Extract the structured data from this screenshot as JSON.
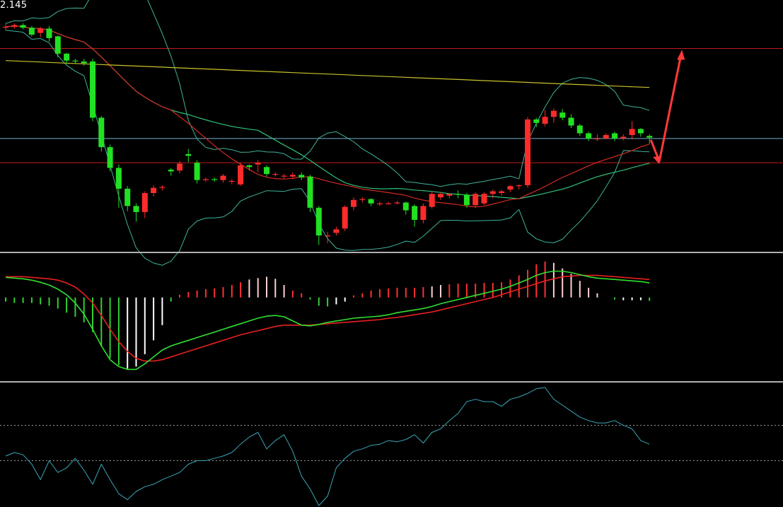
{
  "price_readout": "2.145",
  "colors": {
    "background": "#000000",
    "up_candle": "#ff2b2b",
    "down_candle": "#22e022",
    "boll_bands": "#3fb39a",
    "ma_red": "#d42a22",
    "ma_green": "#2fc27a",
    "ma_yellow": "#c8c22a",
    "level_line": "#c11b1b",
    "current_line": "#6fb0c8",
    "macd_dif": "#30e030",
    "macd_dea": "#e82020",
    "hist_pos": "#ff3030",
    "hist_pos_fade": "#ffd0d0",
    "hist_neg": "#30d030",
    "hist_neg_fade": "#ffffff",
    "oscillator": "#3aa6b9",
    "panel_divider": "#b0b0b0",
    "arrow": "#ff3a3a"
  },
  "chart_data": [
    {
      "type": "candlestick",
      "panel": "price",
      "ylim": [
        1.87,
        2.16
      ],
      "x_count": 75,
      "candles": [
        [
          2.129,
          2.129,
          2.125,
          2.133
        ],
        [
          2.129,
          2.131,
          2.127,
          2.133
        ],
        [
          2.131,
          2.128,
          2.126,
          2.133
        ],
        [
          2.128,
          2.12,
          2.118,
          2.13
        ],
        [
          2.122,
          2.127,
          2.117,
          2.129
        ],
        [
          2.127,
          2.116,
          2.112,
          2.13
        ],
        [
          2.118,
          2.098,
          2.094,
          2.119
        ],
        [
          2.098,
          2.09,
          2.086,
          2.099
        ],
        [
          2.09,
          2.089,
          2.086,
          2.092
        ],
        [
          2.089,
          2.087,
          2.084,
          2.092
        ],
        [
          2.089,
          2.024,
          2.02,
          2.092
        ],
        [
          2.024,
          1.99,
          1.985,
          2.026
        ],
        [
          1.99,
          1.966,
          1.962,
          1.993
        ],
        [
          1.966,
          1.942,
          1.92,
          1.97
        ],
        [
          1.942,
          1.922,
          1.916,
          1.945
        ],
        [
          1.922,
          1.915,
          1.904,
          1.925
        ],
        [
          1.915,
          1.937,
          1.908,
          1.939
        ],
        [
          1.937,
          1.943,
          1.933,
          1.946
        ],
        [
          1.943,
          1.944,
          1.94,
          1.946
        ],
        [
          1.964,
          1.962,
          1.957,
          1.966
        ],
        [
          1.963,
          1.971,
          1.96,
          1.974
        ],
        [
          1.982,
          1.98,
          1.973,
          1.988
        ],
        [
          1.972,
          1.952,
          1.948,
          1.975
        ],
        [
          1.952,
          1.953,
          1.95,
          1.955
        ],
        [
          1.953,
          1.952,
          1.95,
          1.955
        ],
        [
          1.952,
          1.957,
          1.949,
          1.959
        ],
        [
          1.95,
          1.951,
          1.947,
          1.953
        ],
        [
          1.947,
          1.969,
          1.945,
          1.972
        ],
        [
          1.969,
          1.967,
          1.963,
          1.97
        ],
        [
          1.97,
          1.972,
          1.961,
          1.975
        ],
        [
          1.967,
          1.959,
          1.956,
          1.969
        ],
        [
          1.959,
          1.959,
          1.956,
          1.961
        ],
        [
          1.957,
          1.957,
          1.954,
          1.959
        ],
        [
          1.956,
          1.958,
          1.953,
          1.961
        ],
        [
          1.958,
          1.955,
          1.952,
          1.961
        ],
        [
          1.956,
          1.92,
          1.915,
          1.958
        ],
        [
          1.92,
          1.888,
          1.877,
          1.922
        ],
        [
          1.888,
          1.888,
          1.879,
          1.892
        ],
        [
          1.891,
          1.895,
          1.888,
          1.898
        ],
        [
          1.896,
          1.921,
          1.893,
          1.923
        ],
        [
          1.921,
          1.929,
          1.917,
          1.932
        ],
        [
          1.929,
          1.93,
          1.926,
          1.932
        ],
        [
          1.93,
          1.925,
          1.922,
          1.931
        ],
        [
          1.925,
          1.925,
          1.922,
          1.927
        ],
        [
          1.925,
          1.925,
          1.924,
          1.927
        ],
        [
          1.925,
          1.926,
          1.924,
          1.928
        ],
        [
          1.926,
          1.917,
          1.912,
          1.927
        ],
        [
          1.922,
          1.906,
          1.898,
          1.924
        ],
        [
          1.906,
          1.922,
          1.902,
          1.925
        ],
        [
          1.921,
          1.936,
          1.919,
          1.939
        ],
        [
          1.932,
          1.936,
          1.929,
          1.938
        ],
        [
          1.934,
          1.936,
          1.931,
          1.937
        ],
        [
          1.936,
          1.935,
          1.931,
          1.94
        ],
        [
          1.935,
          1.923,
          1.92,
          1.937
        ],
        [
          1.923,
          1.936,
          1.92,
          1.938
        ],
        [
          1.925,
          1.936,
          1.923,
          1.938
        ],
        [
          1.936,
          1.939,
          1.931,
          1.941
        ],
        [
          1.937,
          1.939,
          1.934,
          1.941
        ],
        [
          1.941,
          1.945,
          1.938,
          1.946
        ],
        [
          1.945,
          1.946,
          1.941,
          1.947
        ],
        [
          1.946,
          2.022,
          1.943,
          2.025
        ],
        [
          2.022,
          2.018,
          2.013,
          2.024
        ],
        [
          2.017,
          2.025,
          2.014,
          2.033
        ],
        [
          2.025,
          2.032,
          2.018,
          2.035
        ],
        [
          2.03,
          2.024,
          2.021,
          2.034
        ],
        [
          2.024,
          2.015,
          2.012,
          2.028
        ],
        [
          2.015,
          2.006,
          2.003,
          2.017
        ],
        [
          2.006,
          2.0,
          1.997,
          2.008
        ],
        [
          2.0,
          2.0,
          1.997,
          2.005
        ],
        [
          2.0,
          2.004,
          1.999,
          2.006
        ],
        [
          2.006,
          2.0,
          1.997,
          2.008
        ],
        [
          2.0,
          2.002,
          1.998,
          2.005
        ],
        [
          2.004,
          2.011,
          1.999,
          2.02
        ],
        [
          2.011,
          2.006,
          2.002,
          2.012
        ],
        [
          2.003,
          2.001,
          1.994,
          2.005
        ]
      ],
      "level_lines": [
        2.104,
        1.972
      ],
      "current_line": 2.0
    },
    {
      "type": "bar+line",
      "panel": "macd",
      "ylim": [
        -0.12,
        0.06
      ],
      "x_count": 75,
      "histogram": [
        -0.006,
        -0.008,
        -0.008,
        -0.008,
        -0.01,
        -0.012,
        -0.016,
        -0.022,
        -0.028,
        -0.036,
        -0.05,
        -0.07,
        -0.088,
        -0.098,
        -0.103,
        -0.1,
        -0.082,
        -0.062,
        -0.04,
        -0.006,
        0.004,
        0.008,
        0.01,
        0.012,
        0.013,
        0.015,
        0.018,
        0.022,
        0.026,
        0.028,
        0.03,
        0.027,
        0.018,
        0.01,
        0.006,
        -0.003,
        -0.012,
        -0.013,
        -0.01,
        -0.006,
        0.003,
        0.006,
        0.01,
        0.012,
        0.013,
        0.014,
        0.014,
        0.014,
        0.015,
        0.016,
        0.018,
        0.019,
        0.02,
        0.02,
        0.02,
        0.021,
        0.021,
        0.022,
        0.026,
        0.032,
        0.04,
        0.048,
        0.052,
        0.05,
        0.042,
        0.034,
        0.024,
        0.014,
        0.006,
        0.0,
        -0.003,
        -0.004,
        -0.004,
        -0.004,
        -0.005
      ],
      "histogram_faded": [
        false,
        false,
        false,
        false,
        false,
        false,
        false,
        false,
        false,
        false,
        false,
        false,
        false,
        false,
        true,
        true,
        true,
        true,
        true,
        false,
        false,
        false,
        false,
        false,
        false,
        false,
        false,
        false,
        true,
        true,
        true,
        true,
        true,
        false,
        false,
        false,
        false,
        false,
        true,
        true,
        false,
        false,
        false,
        false,
        false,
        false,
        false,
        false,
        false,
        true,
        true,
        false,
        false,
        false,
        false,
        false,
        false,
        false,
        false,
        false,
        false,
        false,
        false,
        true,
        true,
        true,
        true,
        true,
        true,
        false,
        false,
        true,
        true,
        true,
        false
      ],
      "series": [
        {
          "role": "dif",
          "values": [
            0.029,
            0.028,
            0.027,
            0.025,
            0.022,
            0.018,
            0.012,
            0.004,
            -0.008,
            -0.024,
            -0.046,
            -0.07,
            -0.09,
            -0.1,
            -0.104,
            -0.104,
            -0.096,
            -0.086,
            -0.076,
            -0.07,
            -0.066,
            -0.062,
            -0.058,
            -0.054,
            -0.05,
            -0.046,
            -0.042,
            -0.038,
            -0.034,
            -0.03,
            -0.027,
            -0.026,
            -0.028,
            -0.034,
            -0.04,
            -0.041,
            -0.039,
            -0.036,
            -0.034,
            -0.032,
            -0.03,
            -0.029,
            -0.028,
            -0.027,
            -0.025,
            -0.022,
            -0.02,
            -0.018,
            -0.016,
            -0.013,
            -0.009,
            -0.006,
            -0.003,
            0.0,
            0.003,
            0.006,
            0.009,
            0.012,
            0.016,
            0.021,
            0.026,
            0.032,
            0.036,
            0.038,
            0.038,
            0.036,
            0.033,
            0.03,
            0.028,
            0.027,
            0.026,
            0.025,
            0.024,
            0.023,
            0.021
          ]
        },
        {
          "role": "dea",
          "values": [
            0.03,
            0.03,
            0.03,
            0.029,
            0.028,
            0.027,
            0.025,
            0.021,
            0.015,
            0.005,
            -0.008,
            -0.026,
            -0.046,
            -0.064,
            -0.078,
            -0.088,
            -0.092,
            -0.092,
            -0.09,
            -0.086,
            -0.082,
            -0.078,
            -0.074,
            -0.07,
            -0.066,
            -0.062,
            -0.058,
            -0.054,
            -0.051,
            -0.048,
            -0.045,
            -0.042,
            -0.04,
            -0.04,
            -0.04,
            -0.04,
            -0.039,
            -0.038,
            -0.037,
            -0.036,
            -0.035,
            -0.034,
            -0.033,
            -0.032,
            -0.03,
            -0.029,
            -0.027,
            -0.025,
            -0.023,
            -0.021,
            -0.018,
            -0.015,
            -0.012,
            -0.009,
            -0.006,
            -0.003,
            0.0,
            0.004,
            0.008,
            0.012,
            0.016,
            0.02,
            0.024,
            0.027,
            0.03,
            0.031,
            0.032,
            0.032,
            0.032,
            0.031,
            0.03,
            0.029,
            0.028,
            0.027,
            0.026
          ]
        }
      ]
    },
    {
      "type": "line",
      "panel": "oscillator",
      "ylim": [
        0,
        100
      ],
      "x_count": 75,
      "reference_lines": [
        68,
        38
      ],
      "series": [
        {
          "role": "oscillator",
          "values": [
            42,
            45,
            43,
            35,
            22,
            38,
            28,
            32,
            40,
            30,
            18,
            35,
            22,
            10,
            5,
            12,
            16,
            18,
            22,
            25,
            28,
            35,
            38,
            38,
            40,
            42,
            45,
            52,
            58,
            62,
            48,
            55,
            60,
            46,
            25,
            14,
            0,
            8,
            32,
            40,
            46,
            48,
            51,
            52,
            55,
            54,
            56,
            60,
            53,
            62,
            65,
            72,
            78,
            88,
            90,
            88,
            88,
            84,
            90,
            92,
            95,
            99,
            100,
            90,
            85,
            80,
            75,
            72,
            70,
            70,
            72,
            68,
            65,
            55,
            52
          ]
        }
      ]
    }
  ]
}
